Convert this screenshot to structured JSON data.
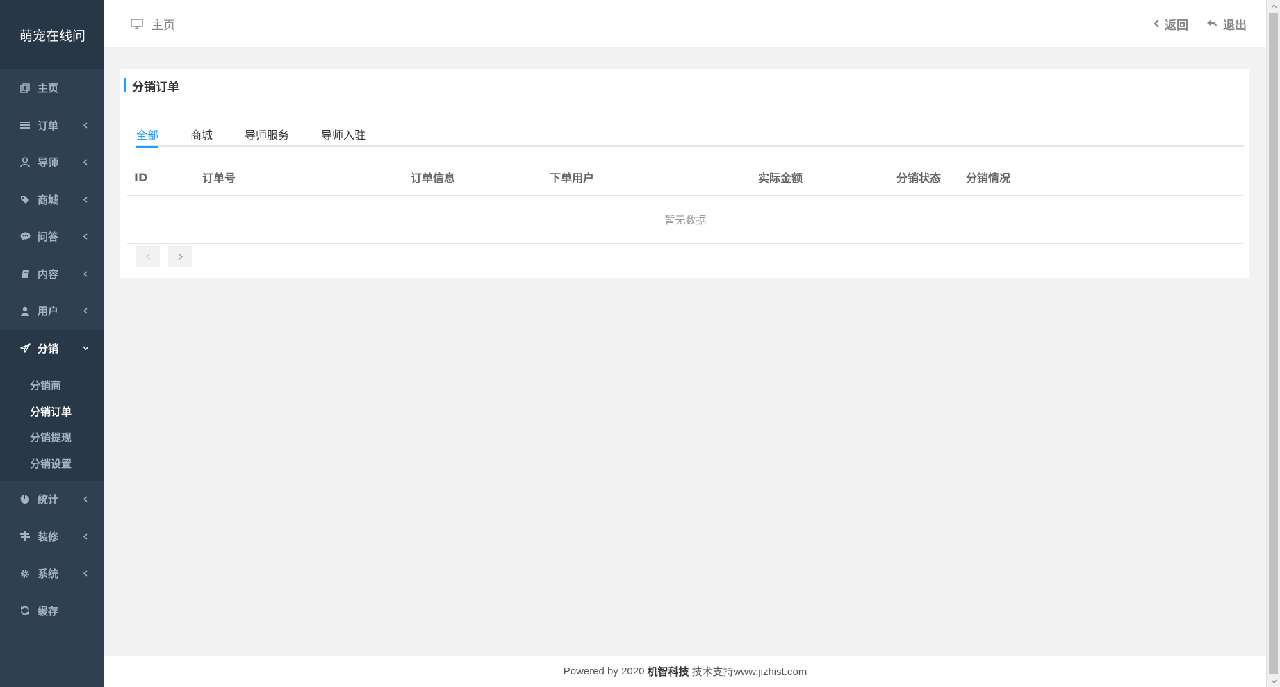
{
  "app": {
    "logo": "萌宠在线问"
  },
  "sidebar": {
    "items": [
      {
        "label": "主页"
      },
      {
        "label": "订单"
      },
      {
        "label": "导师"
      },
      {
        "label": "商城"
      },
      {
        "label": "问答"
      },
      {
        "label": "内容"
      },
      {
        "label": "用户"
      },
      {
        "label": "分销",
        "open": true,
        "children": [
          {
            "label": "分销商"
          },
          {
            "label": "分销订单",
            "active": true
          },
          {
            "label": "分销提现"
          },
          {
            "label": "分销设置"
          }
        ]
      },
      {
        "label": "统计"
      },
      {
        "label": "装修"
      },
      {
        "label": "系统"
      },
      {
        "label": "缓存"
      }
    ]
  },
  "header": {
    "breadcrumb": "主页",
    "back_label": "返回",
    "logout_label": "退出"
  },
  "main": {
    "title": "分销订单",
    "tabs": [
      {
        "label": "全部",
        "active": true
      },
      {
        "label": "商城"
      },
      {
        "label": "导师服务"
      },
      {
        "label": "导师入驻"
      }
    ],
    "table": {
      "columns": [
        "ID",
        "订单号",
        "订单信息",
        "下单用户",
        "实际金额",
        "分销状态",
        "分销情况"
      ],
      "empty_text": "暂无数据"
    }
  },
  "footer": {
    "prefix": "Powered by 2020",
    "company": "机智科技",
    "suffix": "技术支持www.jizhist.com"
  },
  "colors": {
    "sidebar_bg": "#2f4050",
    "accent": "#1e9fff"
  }
}
